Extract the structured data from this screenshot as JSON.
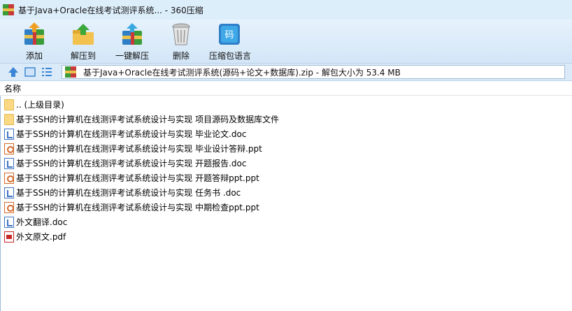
{
  "window": {
    "title": "基于Java+Oracle在线考试测评系统... - 360压缩"
  },
  "toolbar": {
    "items": [
      {
        "label": "添加",
        "icon": "add-archive-icon"
      },
      {
        "label": "解压到",
        "icon": "extract-to-icon"
      },
      {
        "label": "一键解压",
        "icon": "quick-extract-icon"
      },
      {
        "label": "删除",
        "icon": "delete-icon"
      },
      {
        "label": "压缩包语言",
        "icon": "archive-language-icon",
        "glyph": "码"
      }
    ]
  },
  "nav": {
    "path": "基于Java+Oracle在线考试测评系统(源码+论文+数据库).zip - 解包大小为 53.4 MB"
  },
  "list": {
    "header": "名称",
    "files": [
      {
        "name": ".. (上级目录)",
        "type": "folder"
      },
      {
        "name": "基于SSH的计算机在线测评考试系统设计与实现 项目源码及数据库文件",
        "type": "folder"
      },
      {
        "name": "基于SSH的计算机在线测评考试系统设计与实现 毕业论文.doc",
        "type": "doc"
      },
      {
        "name": "基于SSH的计算机在线测评考试系统设计与实现 毕业设计答辩.ppt",
        "type": "ppt"
      },
      {
        "name": "基于SSH的计算机在线测评考试系统设计与实现 开题报告.doc",
        "type": "doc"
      },
      {
        "name": "基于SSH的计算机在线测评考试系统设计与实现 开题答辩ppt.ppt",
        "type": "ppt"
      },
      {
        "name": "基于SSH的计算机在线测评考试系统设计与实现 任务书 .doc",
        "type": "doc"
      },
      {
        "name": "基于SSH的计算机在线测评考试系统设计与实现 中期检查ppt.ppt",
        "type": "ppt"
      },
      {
        "name": "外文翻译.doc",
        "type": "doc"
      },
      {
        "name": "外文原文.pdf",
        "type": "pdf"
      }
    ]
  }
}
